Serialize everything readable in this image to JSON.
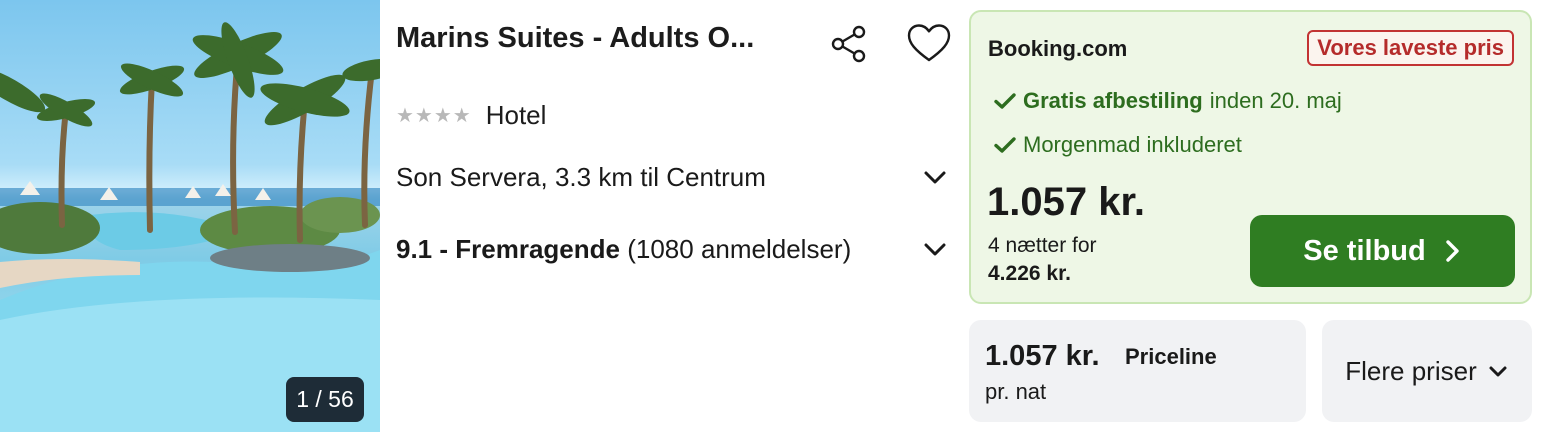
{
  "photo": {
    "counter": "1 / 56"
  },
  "hotel": {
    "name": "Marins Suites - Adults O...",
    "stars": "★★★★",
    "type": "Hotel",
    "location": "Son Servera, 3.3 km til Centrum",
    "rating_score": "9.1 - Fremragende",
    "rating_count": "(1080 anmeldelser)"
  },
  "offer": {
    "provider": "Booking.com",
    "badge": "Vores laveste pris",
    "feature1_bold": "Gratis afbestiling",
    "feature1_rest": "inden 20. maj",
    "feature2": "Morgenmad inkluderet",
    "price": "1.057 kr.",
    "nights_label": "4 nætter for",
    "nights_total": "4.226 kr.",
    "cta_label": "Se tilbud"
  },
  "secondary_offer": {
    "price": "1.057 kr.",
    "provider": "Priceline",
    "unit": "pr. nat"
  },
  "more_prices": {
    "label": "Flere priser"
  },
  "colors": {
    "accent_green": "#2f7d22",
    "offer_bg": "#eef7e6",
    "badge_red": "#b52b2b"
  },
  "icons": [
    "share-icon",
    "heart-icon",
    "chevron-down-icon",
    "check-icon",
    "chevron-right-icon"
  ]
}
